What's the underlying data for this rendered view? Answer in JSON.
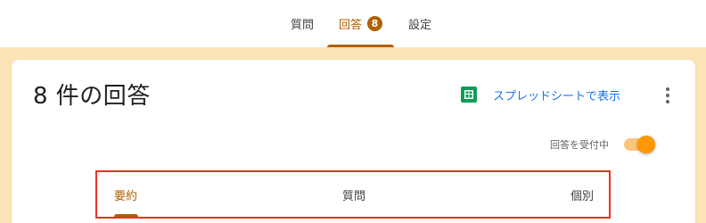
{
  "top_tabs": [
    {
      "label": "質問",
      "active": false
    },
    {
      "label": "回答",
      "active": true,
      "badge": "8"
    },
    {
      "label": "設定",
      "active": false
    }
  ],
  "card": {
    "title": "8 件の回答",
    "sheets_link": {
      "label": "スプレッドシートで表示",
      "icon": "google-sheets-icon"
    },
    "more_icon": "more-vert-icon",
    "accepting": {
      "label": "回答を受付中",
      "on": true
    }
  },
  "sub_tabs": [
    {
      "label": "要約",
      "active": true
    },
    {
      "label": "質問",
      "active": false
    },
    {
      "label": "個別",
      "active": false
    }
  ],
  "colors": {
    "accent": "#b06000",
    "background": "#fde4b8",
    "toggle_thumb": "#ff9800",
    "toggle_track": "#fbc47d",
    "link": "#1a73e8",
    "highlight_box": "#e8321e",
    "sheets_green": "#0f9d58"
  }
}
